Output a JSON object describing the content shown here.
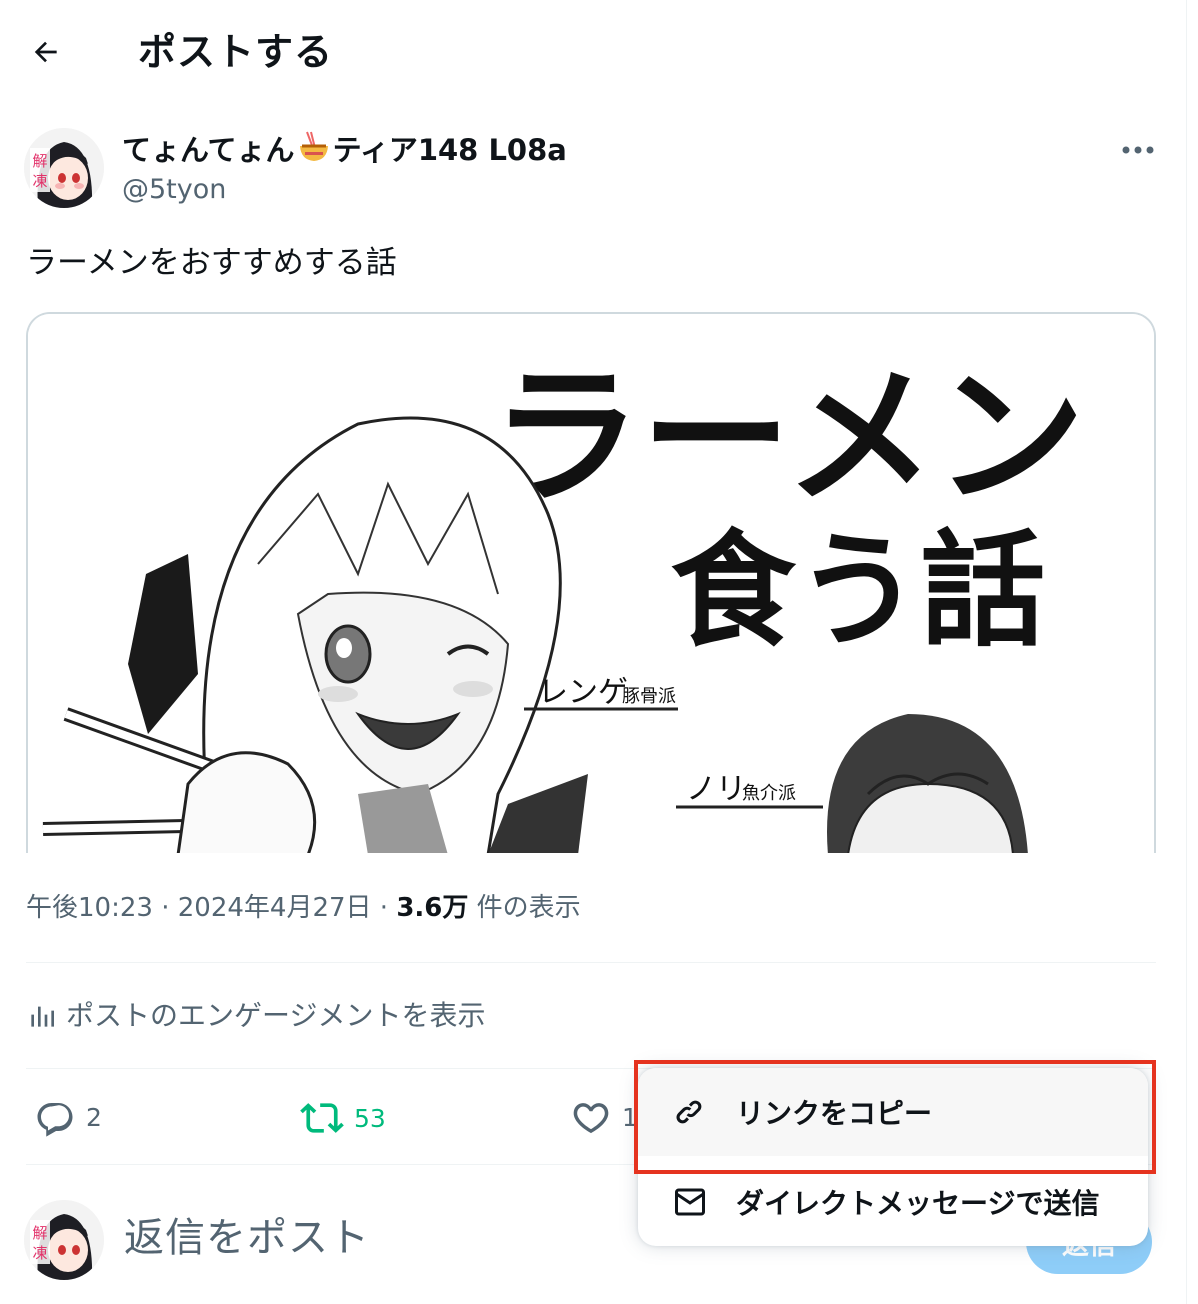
{
  "header": {
    "title": "ポストする"
  },
  "post": {
    "author_name": "てょんてょん",
    "author_name_suffix": "ティア148 L08a",
    "handle": "@5tyon",
    "text": "ラーメンをおすすめする話",
    "image": {
      "title_line1": "ラーメン",
      "title_line2": "食う話",
      "char1_label": "レンゲ",
      "char1_sub": "豚骨派",
      "char2_label": "ノリ",
      "char2_sub": "魚介派"
    },
    "time": "午後10:23",
    "date": "2024年4月27日",
    "views": "3.6万",
    "views_label": "件の表示",
    "engagement_link": "ポストのエンゲージメントを表示",
    "reply_count": "2",
    "repost_count": "53",
    "like_count": "1"
  },
  "composer": {
    "placeholder": "返信をポスト",
    "reply_button": "返信"
  },
  "share_menu": {
    "items": [
      {
        "label": "リンクをコピー",
        "icon": "link-icon"
      },
      {
        "label": "ダイレクトメッセージで送信",
        "icon": "envelope-icon"
      }
    ]
  },
  "colors": {
    "repost": "#00ba7c",
    "highlight_box": "#e5331f",
    "muted": "#536471",
    "reply_button": "#8ecdf8"
  }
}
